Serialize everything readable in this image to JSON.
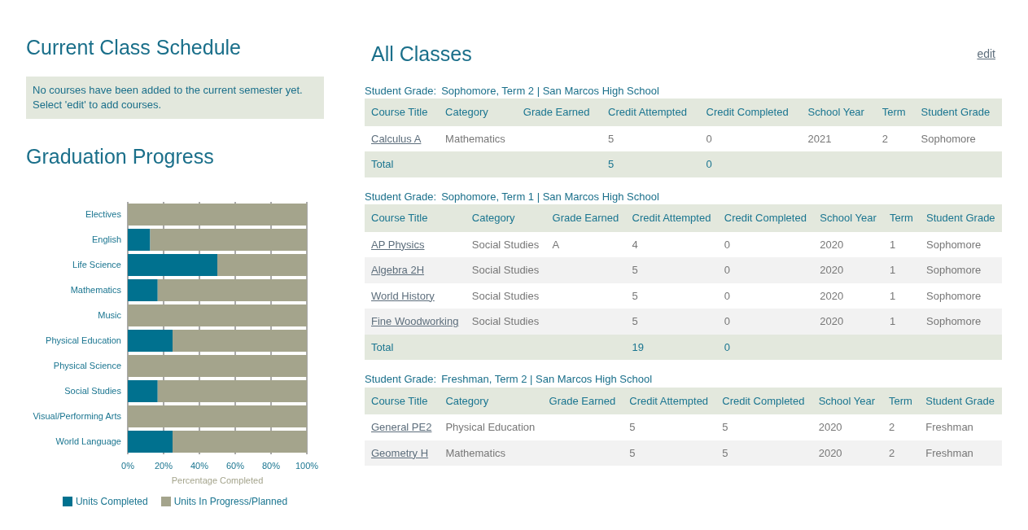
{
  "schedule": {
    "title": "Current Class Schedule",
    "notice": "No courses have been added to the current semester yet. Select 'edit' to add courses."
  },
  "progress": {
    "title": "Graduation Progress",
    "chart_data": {
      "type": "bar",
      "orientation": "horizontal",
      "stacked": true,
      "grid": true,
      "xlabel": "Percentage Completed",
      "categories": [
        "Electives",
        "English",
        "Life Science",
        "Mathematics",
        "Music",
        "Physical Education",
        "Physical Science",
        "Social Studies",
        "Visual/Performing Arts",
        "World Language"
      ],
      "series": [
        {
          "name": "Units Completed",
          "color": "#00718f",
          "values": [
            0,
            12.5,
            50,
            16.7,
            0,
            25,
            0,
            16.7,
            0,
            25
          ]
        },
        {
          "name": "Units In Progress/Planned",
          "color": "#a4a48c",
          "values": [
            100,
            87.5,
            50,
            83.3,
            100,
            75,
            100,
            83.3,
            100,
            75
          ]
        }
      ],
      "xlim": [
        0,
        100
      ],
      "xticks": [
        {
          "value": 0,
          "label": "0%"
        },
        {
          "value": 20,
          "label": "20%"
        },
        {
          "value": 40,
          "label": "40%"
        },
        {
          "value": 60,
          "label": "60%"
        },
        {
          "value": 80,
          "label": "80%"
        },
        {
          "value": 100,
          "label": "100%"
        }
      ]
    }
  },
  "classes": {
    "title": "All Classes",
    "edit": "edit",
    "terms": [
      {
        "caption_label": "Student Grade:",
        "caption": "Sophomore, Term 2 | San Marcos High School",
        "columns": [
          "Course Title",
          "Category",
          "Grade Earned",
          "Credit Attempted",
          "Credit Completed",
          "School Year",
          "Term",
          "Student Grade"
        ],
        "rows": [
          {
            "title": "Calculus A",
            "category": "Mathematics",
            "attempted": "5",
            "completed": "0",
            "year": "2021",
            "term": "2",
            "student_grade": "Sophomore"
          }
        ],
        "total": {
          "label": "Total",
          "attempted": "5",
          "completed": "0"
        }
      },
      {
        "caption_label": "Student Grade:",
        "caption": "Sophomore, Term 1 | San Marcos High School",
        "columns": [
          "Course Title",
          "Category",
          "Grade Earned",
          "Credit Attempted",
          "Credit Completed",
          "School Year",
          "Term",
          "Student Grade"
        ],
        "rows": [
          {
            "title": "AP Physics",
            "category": "Social Studies",
            "grade": "A",
            "attempted": "4",
            "completed": "0",
            "year": "2020",
            "term": "1",
            "student_grade": "Sophomore"
          },
          {
            "title": "Algebra 2H",
            "category": "Social Studies",
            "attempted": "5",
            "completed": "0",
            "year": "2020",
            "term": "1",
            "student_grade": "Sophomore"
          },
          {
            "title": "World History",
            "category": "Social Studies",
            "attempted": "5",
            "completed": "0",
            "year": "2020",
            "term": "1",
            "student_grade": "Sophomore"
          },
          {
            "title": "Fine Woodworking",
            "category": "Social Studies",
            "attempted": "5",
            "completed": "0",
            "year": "2020",
            "term": "1",
            "student_grade": "Sophomore"
          }
        ],
        "total": {
          "label": "Total",
          "attempted": "19",
          "completed": "0"
        }
      },
      {
        "caption_label": "Student Grade:",
        "caption": "Freshman, Term 2 | San Marcos High School",
        "columns": [
          "Course Title",
          "Category",
          "Grade Earned",
          "Credit Attempted",
          "Credit Completed",
          "School Year",
          "Term",
          "Student Grade"
        ],
        "rows": [
          {
            "title": "General PE2",
            "category": "Physical Education",
            "attempted": "5",
            "completed": "5",
            "year": "2020",
            "term": "2",
            "student_grade": "Freshman"
          },
          {
            "title": "Geometry H",
            "category": "Mathematics",
            "attempted": "5",
            "completed": "5",
            "year": "2020",
            "term": "2",
            "student_grade": "Freshman"
          }
        ]
      }
    ]
  }
}
